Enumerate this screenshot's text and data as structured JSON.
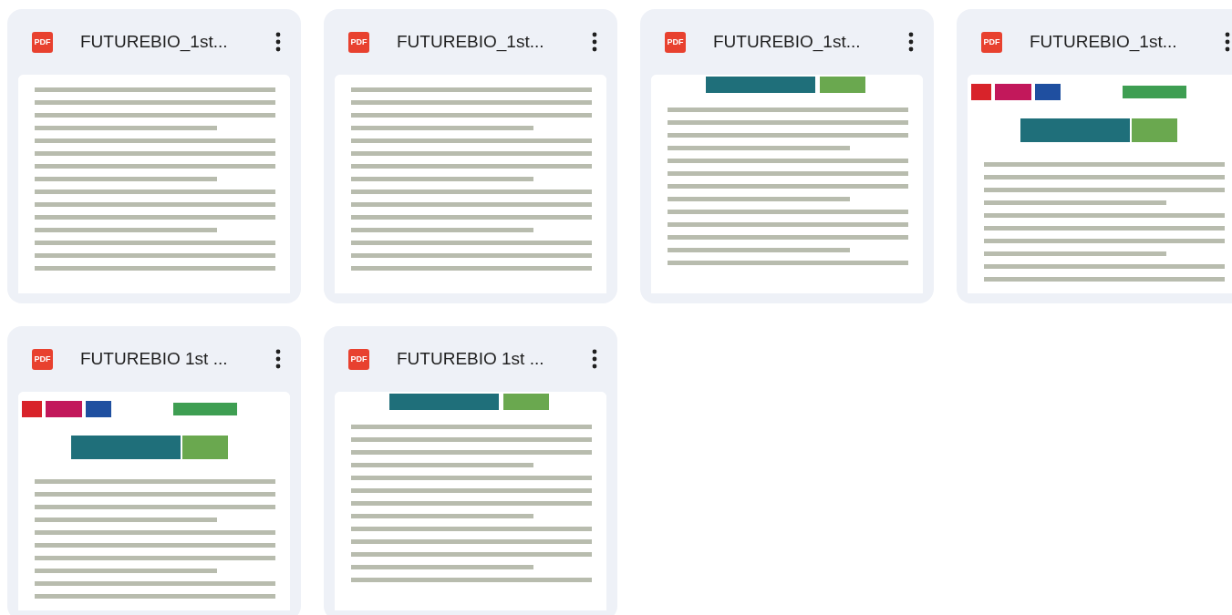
{
  "files": [
    {
      "type_badge": "PDF",
      "name": "FUTUREBIO_1st...",
      "kind": "plain"
    },
    {
      "type_badge": "PDF",
      "name": "FUTUREBIO_1st...",
      "kind": "plain"
    },
    {
      "type_badge": "PDF",
      "name": "FUTUREBIO_1st...",
      "kind": "logo"
    },
    {
      "type_badge": "PDF",
      "name": "FUTUREBIO_1st...",
      "kind": "banner"
    },
    {
      "type_badge": "PDF",
      "name": "FUTUREBIO 1st ...",
      "kind": "banner"
    },
    {
      "type_badge": "PDF",
      "name": "FUTUREBIO 1st ...",
      "kind": "logo"
    }
  ]
}
